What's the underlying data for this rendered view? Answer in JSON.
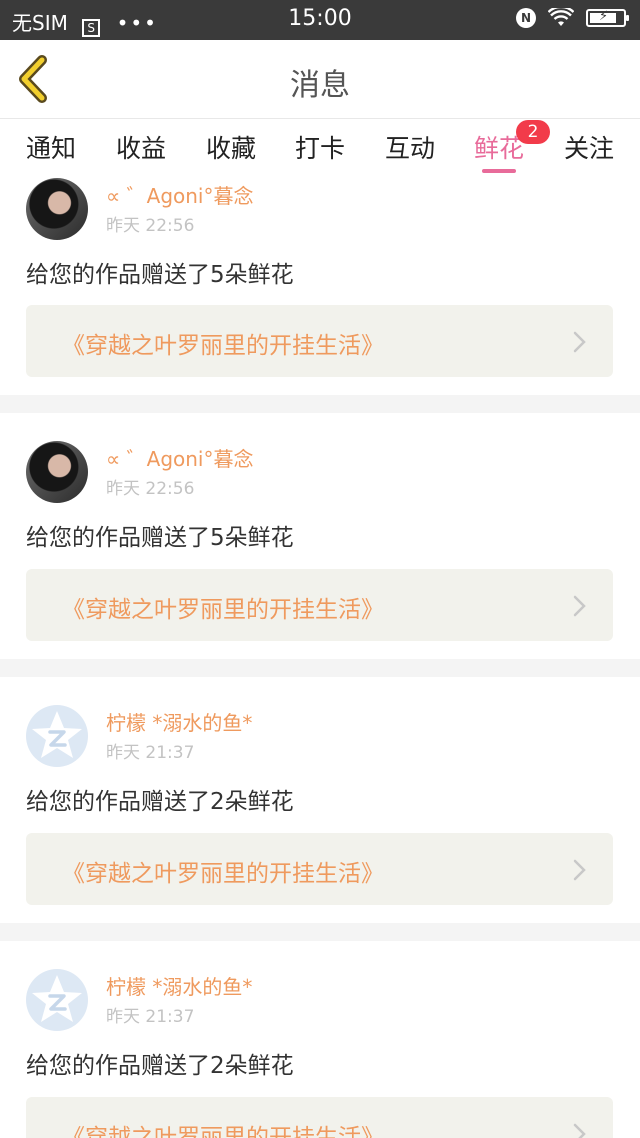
{
  "status_bar": {
    "carrier": "无SIM",
    "sim_icon": "S",
    "dots": "•••",
    "time": "15:00",
    "nfc": "N",
    "battery_bolt": "⚡"
  },
  "header": {
    "title": "消息",
    "back_icon": "chevron-left-icon"
  },
  "tabs": [
    {
      "label": "通知"
    },
    {
      "label": "收益"
    },
    {
      "label": "收藏"
    },
    {
      "label": "打卡"
    },
    {
      "label": "互动"
    },
    {
      "label": "鲜花",
      "active": true,
      "badge": "2"
    },
    {
      "label": "关注"
    }
  ],
  "colors": {
    "accent": "#e86b9a",
    "name": "#ef9a5e",
    "badge": "#f23b4a"
  },
  "messages": [
    {
      "user": "∝ ゛Agoni°暮念",
      "time": "昨天 22:56",
      "text": "给您的作品赠送了5朵鲜花",
      "work": "《穿越之叶罗丽里的开挂生活》",
      "avatar": "photo"
    },
    {
      "user": "∝ ゛Agoni°暮念",
      "time": "昨天 22:56",
      "text": "给您的作品赠送了5朵鲜花",
      "work": "《穿越之叶罗丽里的开挂生活》",
      "avatar": "photo"
    },
    {
      "user": "柠檬 *溺水的鱼*",
      "time": "昨天 21:37",
      "text": "给您的作品赠送了2朵鲜花",
      "work": "《穿越之叶罗丽里的开挂生活》",
      "avatar": "default-star"
    },
    {
      "user": "柠檬 *溺水的鱼*",
      "time": "昨天 21:37",
      "text": "给您的作品赠送了2朵鲜花",
      "work": "《穿越之叶罗丽里的开挂生活》",
      "avatar": "default-star"
    }
  ]
}
